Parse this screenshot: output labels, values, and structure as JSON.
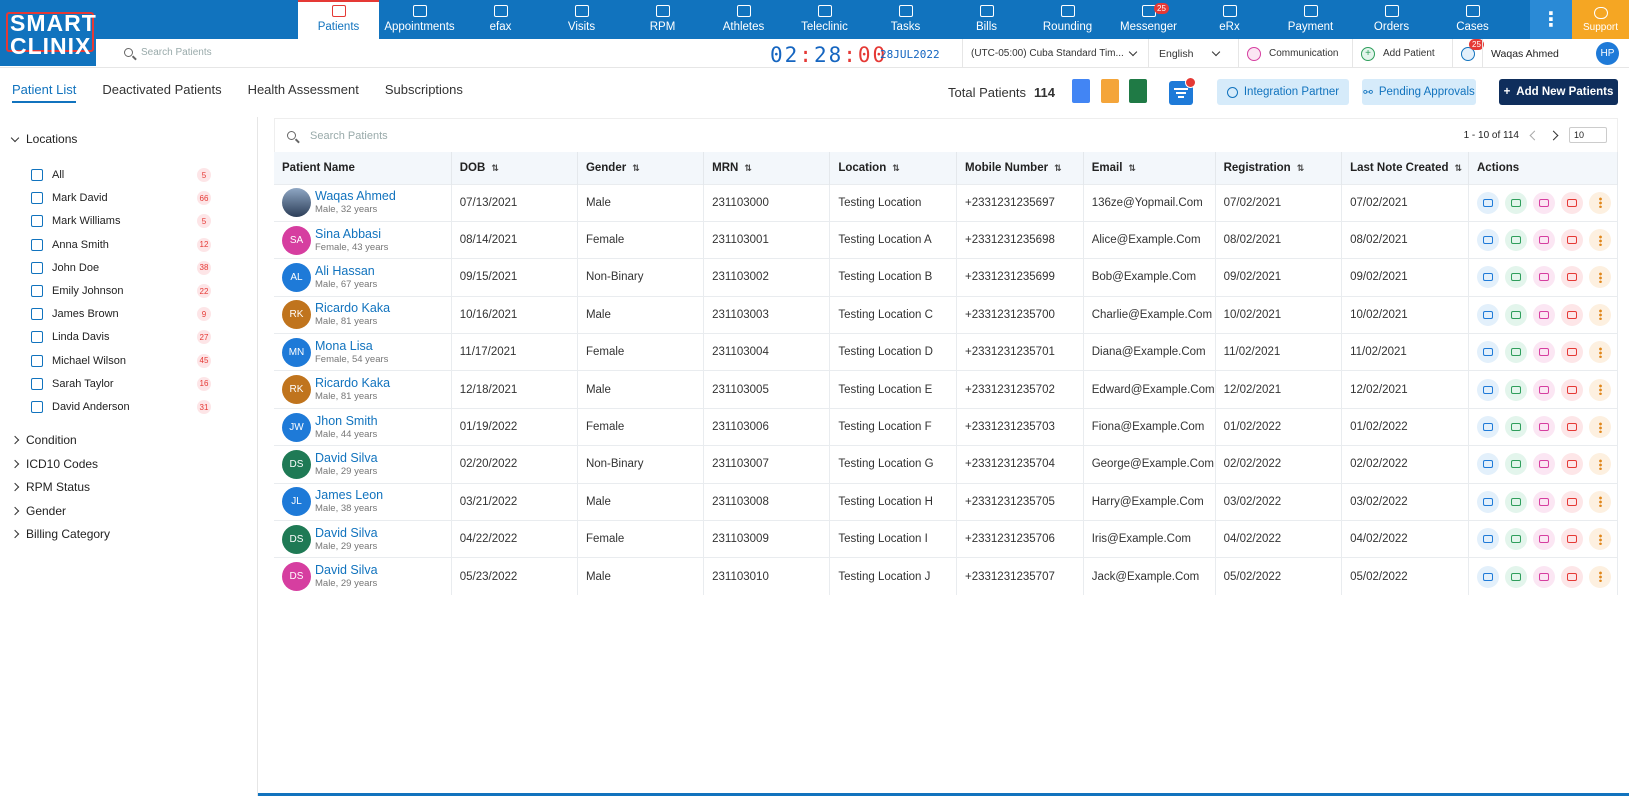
{
  "brand": {
    "line1": "SMART",
    "line2": "CLINIX"
  },
  "nav": [
    {
      "label": "Patients",
      "active": true
    },
    {
      "label": "Appointments"
    },
    {
      "label": "efax"
    },
    {
      "label": "Visits"
    },
    {
      "label": "RPM"
    },
    {
      "label": "Athletes"
    },
    {
      "label": "Teleclinic"
    },
    {
      "label": "Tasks"
    },
    {
      "label": "Bills"
    },
    {
      "label": "Rounding"
    },
    {
      "label": "Messenger",
      "badge": "25"
    },
    {
      "label": "eRx"
    },
    {
      "label": "Payment"
    },
    {
      "label": "Orders"
    },
    {
      "label": "Cases"
    }
  ],
  "support_label": "Support",
  "global_search": {
    "placeholder": "Search Patients"
  },
  "clock": {
    "hh": "02",
    "mm": "28",
    "ss": "00",
    "date": "28JUL2022"
  },
  "timezone": "(UTC-05:00) Cuba Standard Tim...",
  "language": "English",
  "communication_label": "Communication",
  "add_patient_label": "Add Patient",
  "notifications_badge": "25",
  "user": {
    "name": "Waqas Ahmed",
    "initials": "HP"
  },
  "tabs": [
    "Patient List",
    "Deactivated Patients",
    "Health Assessment",
    "Subscriptions"
  ],
  "total": {
    "label": "Total Patients",
    "value": "114"
  },
  "buttons": {
    "integration": "Integration Partner",
    "pending": "Pending Approvals",
    "add_new": "Add New Patients"
  },
  "sidebar": {
    "locations_title": "Locations",
    "locations": [
      {
        "name": "All",
        "count": "5"
      },
      {
        "name": "Mark David",
        "count": "66"
      },
      {
        "name": "Mark Williams",
        "count": "5"
      },
      {
        "name": "Anna Smith",
        "count": "12"
      },
      {
        "name": "John Doe",
        "count": "38"
      },
      {
        "name": "Emily Johnson",
        "count": "22"
      },
      {
        "name": "James Brown",
        "count": "9"
      },
      {
        "name": "Linda Davis",
        "count": "27"
      },
      {
        "name": "Michael Wilson",
        "count": "45"
      },
      {
        "name": "Sarah Taylor",
        "count": "16"
      },
      {
        "name": "David Anderson",
        "count": "31"
      }
    ],
    "filters": [
      "Condition",
      "ICD10 Codes",
      "RPM Status",
      "Gender",
      "Billing Category"
    ]
  },
  "table": {
    "search_placeholder": "Search Patients",
    "pager": {
      "range": "1 - 10 of 114",
      "page_size": "10"
    },
    "columns": [
      "Patient Name",
      "DOB",
      "Gender",
      "MRN",
      "Location",
      "Mobile Number",
      "Email",
      "Registration",
      "Last Note Created",
      "Actions"
    ],
    "rows": [
      {
        "initials": "",
        "color": "#3d5a80",
        "name": "Waqas Ahmed",
        "sub": "Male, 32 years",
        "dob": "07/13/2021",
        "gender": "Male",
        "mrn": "231103000",
        "location": "Testing Location",
        "mobile": "+2331231235697",
        "email": "136ze@Yopmail.Com",
        "reg": "07/02/2021",
        "note": "07/02/2021"
      },
      {
        "initials": "SA",
        "color": "#d63ea0",
        "name": "Sina Abbasi",
        "sub": "Female, 43 years",
        "dob": "08/14/2021",
        "gender": "Female",
        "mrn": "231103001",
        "location": "Testing Location A",
        "mobile": "+2331231235698",
        "email": "Alice@Example.Com",
        "reg": "08/02/2021",
        "note": "08/02/2021"
      },
      {
        "initials": "AL",
        "color": "#1e7ad8",
        "name": "Ali Hassan",
        "sub": "Male, 67 years",
        "dob": "09/15/2021",
        "gender": "Non-Binary",
        "mrn": "231103002",
        "location": "Testing Location B",
        "mobile": "+2331231235699",
        "email": "Bob@Example.Com",
        "reg": "09/02/2021",
        "note": "09/02/2021"
      },
      {
        "initials": "RK",
        "color": "#c0741d",
        "name": "Ricardo Kaka",
        "sub": "Male, 81 years",
        "dob": "10/16/2021",
        "gender": "Male",
        "mrn": "231103003",
        "location": "Testing Location C",
        "mobile": "+2331231235700",
        "email": "Charlie@Example.Com",
        "reg": "10/02/2021",
        "note": "10/02/2021"
      },
      {
        "initials": "MN",
        "color": "#1e7ad8",
        "name": "Mona Lisa",
        "sub": "Female, 54 years",
        "dob": "11/17/2021",
        "gender": "Female",
        "mrn": "231103004",
        "location": "Testing Location D",
        "mobile": "+2331231235701",
        "email": "Diana@Example.Com",
        "reg": "11/02/2021",
        "note": "11/02/2021"
      },
      {
        "initials": "RK",
        "color": "#c0741d",
        "name": "Ricardo Kaka",
        "sub": "Male, 81 years",
        "dob": "12/18/2021",
        "gender": "Male",
        "mrn": "231103005",
        "location": "Testing Location E",
        "mobile": "+2331231235702",
        "email": "Edward@Example.Com",
        "reg": "12/02/2021",
        "note": "12/02/2021"
      },
      {
        "initials": "JW",
        "color": "#1e7ad8",
        "name": "Jhon Smith",
        "sub": "Male, 44 years",
        "dob": "01/19/2022",
        "gender": "Female",
        "mrn": "231103006",
        "location": "Testing Location F",
        "mobile": "+2331231235703",
        "email": "Fiona@Example.Com",
        "reg": "01/02/2022",
        "note": "01/02/2022"
      },
      {
        "initials": "DS",
        "color": "#1f7a55",
        "name": "David Silva",
        "sub": "Male, 29 years",
        "dob": "02/20/2022",
        "gender": "Non-Binary",
        "mrn": "231103007",
        "location": "Testing Location G",
        "mobile": "+2331231235704",
        "email": "George@Example.Com",
        "reg": "02/02/2022",
        "note": "02/02/2022"
      },
      {
        "initials": "JL",
        "color": "#1e7ad8",
        "name": "James Leon",
        "sub": "Male, 38 years",
        "dob": "03/21/2022",
        "gender": "Male",
        "mrn": "231103008",
        "location": "Testing Location H",
        "mobile": "+2331231235705",
        "email": "Harry@Example.Com",
        "reg": "03/02/2022",
        "note": "03/02/2022"
      },
      {
        "initials": "DS",
        "color": "#1f7a55",
        "name": "David Silva",
        "sub": "Male, 29 years",
        "dob": "04/22/2022",
        "gender": "Female",
        "mrn": "231103009",
        "location": "Testing Location I",
        "mobile": "+2331231235706",
        "email": "Iris@Example.Com",
        "reg": "04/02/2022",
        "note": "04/02/2022"
      },
      {
        "initials": "DS",
        "color": "#d63ea0",
        "name": "David Silva",
        "sub": "Male, 29 years",
        "dob": "05/23/2022",
        "gender": "Male",
        "mrn": "231103010",
        "location": "Testing Location J",
        "mobile": "+2331231235707",
        "email": "Jack@Example.Com",
        "reg": "05/02/2022",
        "note": "05/02/2022"
      }
    ]
  }
}
